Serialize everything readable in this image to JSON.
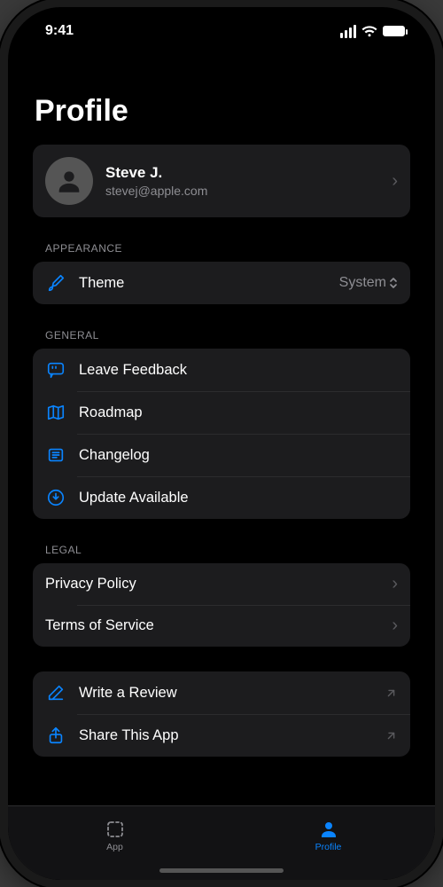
{
  "status": {
    "time": "9:41"
  },
  "title": "Profile",
  "profile": {
    "name": "Steve J.",
    "email": "stevej@apple.com"
  },
  "sections": {
    "appearance": {
      "header": "APPEARANCE",
      "theme": {
        "label": "Theme",
        "value": "System"
      }
    },
    "general": {
      "header": "GENERAL",
      "feedback": "Leave Feedback",
      "roadmap": "Roadmap",
      "changelog": "Changelog",
      "update": "Update Available"
    },
    "legal": {
      "header": "LEGAL",
      "privacy": "Privacy Policy",
      "terms": "Terms of Service"
    },
    "extra": {
      "review": "Write a Review",
      "share": "Share This App"
    }
  },
  "tabs": {
    "app": "App",
    "profile": "Profile"
  },
  "accent": "#0a84ff"
}
